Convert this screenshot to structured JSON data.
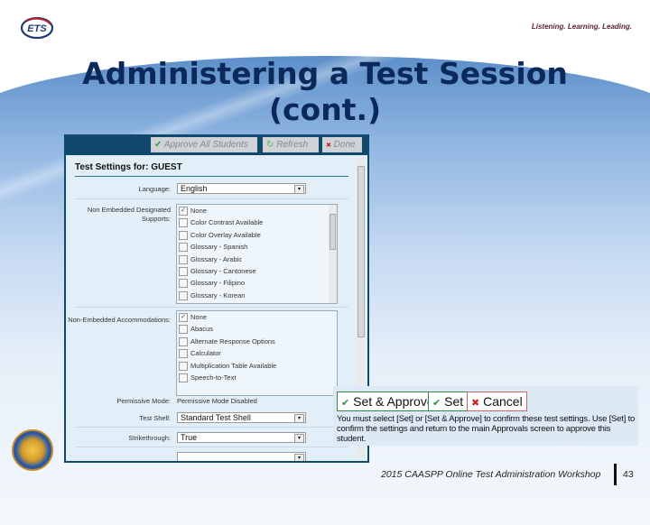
{
  "slide": {
    "title_line1": "Administering a Test Session",
    "title_line2": "(cont.)",
    "logo_text": "ETS",
    "tagline": "Listening. Learning. Leading.",
    "footer": "2015 CAASPP Online Test Administration Workshop",
    "page_number": "43"
  },
  "toolbar": {
    "approve_all": "Approve All Students",
    "refresh": "Refresh",
    "done": "Done"
  },
  "settings": {
    "heading": "Test Settings for: GUEST",
    "language_label": "Language:",
    "language_value": "English",
    "designated_label": "Non Embedded Designated Supports:",
    "designated_items": [
      {
        "label": "None",
        "checked": true
      },
      {
        "label": "Color Contrast Available",
        "checked": false
      },
      {
        "label": "Color Overlay Available",
        "checked": false
      },
      {
        "label": "Glossary - Spanish",
        "checked": false
      },
      {
        "label": "Glossary - Arabic",
        "checked": false
      },
      {
        "label": "Glossary - Cantonese",
        "checked": false
      },
      {
        "label": "Glossary - Filipino",
        "checked": false
      },
      {
        "label": "Glossary - Korean",
        "checked": false
      }
    ],
    "accommodations_label": "Non-Embedded Accommodations:",
    "accommodation_items": [
      {
        "label": "None",
        "checked": true
      },
      {
        "label": "Abacus",
        "checked": false
      },
      {
        "label": "Alternate Response Options",
        "checked": false
      },
      {
        "label": "Calculator",
        "checked": false
      },
      {
        "label": "Multiplication Table Available",
        "checked": false
      },
      {
        "label": "Speech-to-Text",
        "checked": false
      }
    ],
    "permissive_label": "Permissive Mode:",
    "permissive_value": "Permissive Mode Disabled",
    "test_shell_label": "Test Shell:",
    "test_shell_value": "Standard Test Shell",
    "strikethrough_label": "Strikethrough:",
    "strikethrough_value": "True"
  },
  "callout": {
    "set_approve": "Set & Approve",
    "set": "Set",
    "cancel": "Cancel",
    "note": "You must select [Set] or [Set & Approve] to confirm these test settings. Use [Set] to confirm the settings and return to the main Approvals screen to approve this student."
  },
  "icons": {
    "check": "✔",
    "x": "✖",
    "refresh": "↻",
    "arrow_down": "▾",
    "arrow_up": "▴"
  },
  "colors": {
    "title": "#0b2a5b",
    "app_frame": "#11496c",
    "panel": "#e3eff8",
    "approve_green": "#2d8a4a",
    "cancel_red": "#c22"
  }
}
